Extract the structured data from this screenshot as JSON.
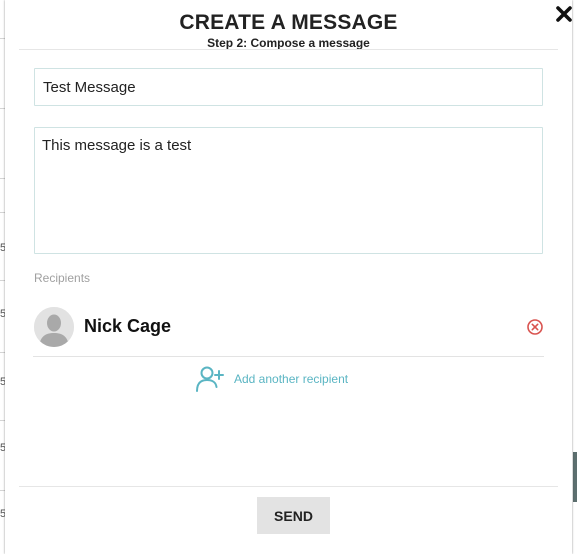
{
  "modal": {
    "title": "CREATE A MESSAGE",
    "subtitle": "Step 2: Compose a message",
    "close_icon": "close-x-icon"
  },
  "form": {
    "subject_value": "Test Message",
    "body_value": "This message is a test"
  },
  "recipients": {
    "label": "Recipients",
    "items": [
      {
        "name": "Nick Cage",
        "avatar_icon": "user-silhouette-icon",
        "remove_icon": "remove-circle-icon"
      }
    ],
    "add_label": "Add another recipient",
    "add_icon": "add-user-icon"
  },
  "actions": {
    "send_label": "SEND"
  },
  "background": {
    "edge_digits": [
      "5",
      "5",
      "5",
      "5",
      "5"
    ]
  },
  "colors": {
    "accent": "#5ab5c3",
    "remove": "#d9534f",
    "input_border": "#cfe3e3",
    "button_bg": "#e3e3e3"
  }
}
